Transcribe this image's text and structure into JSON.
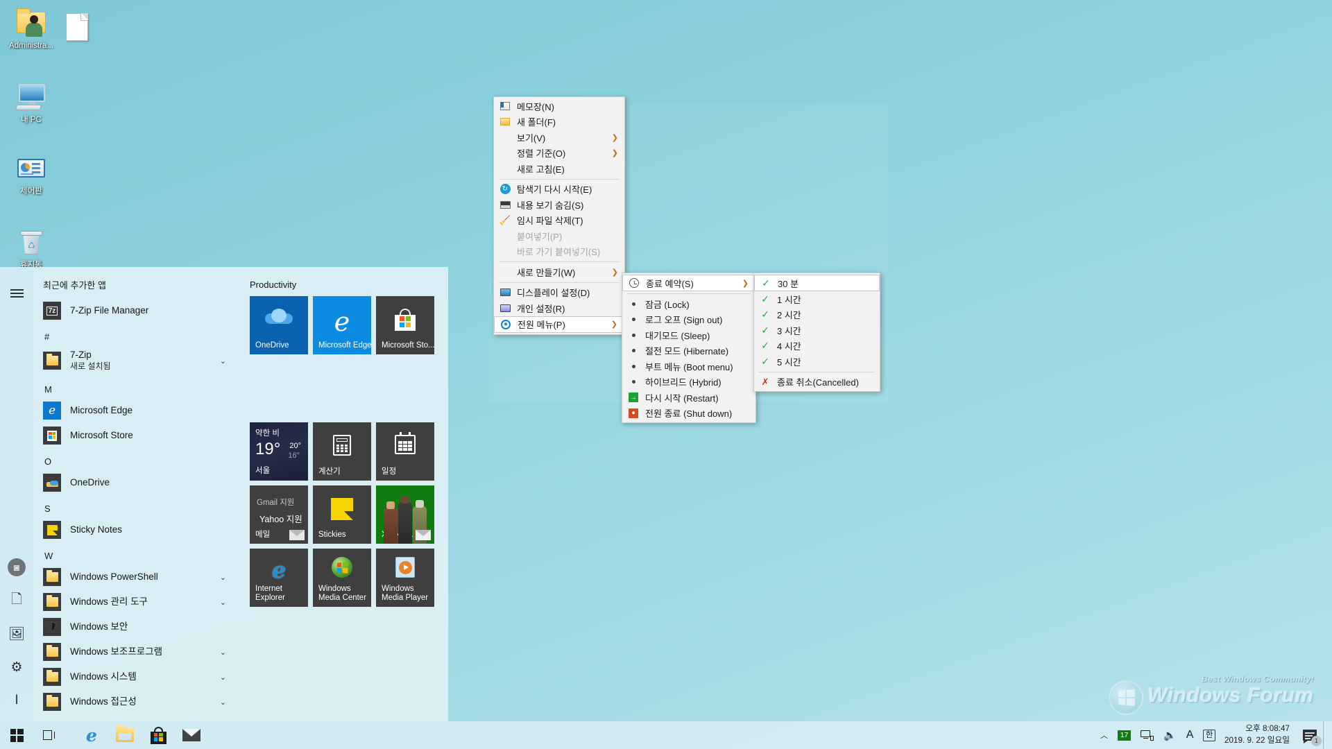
{
  "desktop": {
    "icons": [
      {
        "name": "administrator-folder",
        "label": "Administra...",
        "icon": "user-folder-icon"
      },
      {
        "name": "text-document",
        "label": "",
        "icon": "blank-document-icon"
      },
      {
        "name": "my-pc",
        "label": "내 PC",
        "icon": "computer-icon"
      },
      {
        "name": "control-panel",
        "label": "제어판",
        "icon": "control-panel-icon"
      },
      {
        "name": "recycle-bin",
        "label": "휴지통",
        "icon": "recycle-bin-icon"
      }
    ],
    "watermark": {
      "tagline": "Best Windows Community!",
      "title": "Windows Forum"
    },
    "background_color": "#8ed2de"
  },
  "start_menu": {
    "rail": [
      {
        "name": "hamburger",
        "icon": "hamburger-icon",
        "label": ""
      },
      {
        "name": "account",
        "icon": "user-avatar-icon",
        "label": ""
      },
      {
        "name": "documents",
        "icon": "document-icon",
        "label": ""
      },
      {
        "name": "pictures",
        "icon": "picture-icon",
        "label": ""
      },
      {
        "name": "settings",
        "icon": "gear-icon",
        "label": ""
      },
      {
        "name": "power",
        "icon": "power-icon",
        "label": ""
      }
    ],
    "recent_header": "최근에 추가한 앱",
    "recent_apps": [
      {
        "label": "7-Zip File Manager",
        "icon": "7zip-icon"
      }
    ],
    "sections": [
      {
        "letter": "#",
        "apps": [
          {
            "label": "7-Zip",
            "sub": "새로 설치됨",
            "icon": "folder-icon",
            "chevron": "⌄"
          }
        ]
      },
      {
        "letter": "M",
        "apps": [
          {
            "label": "Microsoft Edge",
            "sub": "",
            "icon": "edge-icon",
            "chevron": ""
          },
          {
            "label": "Microsoft Store",
            "sub": "",
            "icon": "store-icon",
            "chevron": ""
          }
        ]
      },
      {
        "letter": "O",
        "apps": [
          {
            "label": "OneDrive",
            "sub": "",
            "icon": "onedrive-icon",
            "chevron": ""
          }
        ]
      },
      {
        "letter": "S",
        "apps": [
          {
            "label": "Sticky Notes",
            "sub": "",
            "icon": "sticky-notes-icon",
            "chevron": ""
          }
        ]
      },
      {
        "letter": "W",
        "apps": [
          {
            "label": "Windows PowerShell",
            "sub": "",
            "icon": "folder-icon",
            "chevron": "⌄"
          },
          {
            "label": "Windows 관리 도구",
            "sub": "",
            "icon": "folder-icon",
            "chevron": "⌄"
          },
          {
            "label": "Windows 보안",
            "sub": "",
            "icon": "shield-icon",
            "chevron": ""
          },
          {
            "label": "Windows 보조프로그램",
            "sub": "",
            "icon": "folder-icon",
            "chevron": "⌄"
          },
          {
            "label": "Windows 시스템",
            "sub": "",
            "icon": "folder-icon",
            "chevron": "⌄"
          },
          {
            "label": "Windows 접근성",
            "sub": "",
            "icon": "folder-icon",
            "chevron": "⌄"
          }
        ]
      }
    ],
    "tile_group": "Productivity",
    "tiles_row1": [
      {
        "label": "OneDrive",
        "icon": "onedrive-icon",
        "color": "#0b63b0"
      },
      {
        "label": "Microsoft Edge",
        "icon": "edge-icon",
        "color": "#0b8ce0"
      },
      {
        "label": "Microsoft Sto...",
        "icon": "store-icon",
        "color": "#3f3f3f"
      }
    ],
    "weather_tile": {
      "condition": "약한 비",
      "temp_now": "19°",
      "temp_high": "20°",
      "temp_low": "16°",
      "city": "서울"
    },
    "tiles_row2": [
      {
        "label": "계산기",
        "icon": "calculator-icon",
        "color": "#3f3f3f"
      },
      {
        "label": "일정",
        "icon": "calendar-icon",
        "color": "#3f3f3f"
      }
    ],
    "mail_tile": {
      "ghost_top": "Gmail 지원",
      "ghost_mid": "Yahoo 지원",
      "label": "메일"
    },
    "tiles_row3": [
      {
        "label": "Stickies",
        "icon": "sticky-notes-icon",
        "color": "#3f3f3f"
      },
      {
        "label": "Xbox 본...",
        "icon": "xbox-icon",
        "color": "#107c10"
      }
    ],
    "tiles_row4": [
      {
        "label": "Internet Explorer",
        "icon": "internet-explorer-icon",
        "color": "#3f3f3f"
      },
      {
        "label": "Windows Media Center",
        "icon": "media-center-icon",
        "color": "#3f3f3f"
      },
      {
        "label": "Windows Media Player",
        "icon": "media-player-icon",
        "color": "#3f3f3f"
      }
    ]
  },
  "context_menu": {
    "items": [
      {
        "label": "메모장(N)",
        "icon": "notepad-icon",
        "arrow": "",
        "state": "normal"
      },
      {
        "label": "새 폴더(F)",
        "icon": "new-folder-icon",
        "arrow": "",
        "state": "normal"
      },
      {
        "label": "보기(V)",
        "icon": "",
        "arrow": "❯",
        "state": "normal"
      },
      {
        "label": "정렬 기준(O)",
        "icon": "",
        "arrow": "❯",
        "state": "normal"
      },
      {
        "label": "새로 고침(E)",
        "icon": "",
        "arrow": "",
        "state": "normal"
      },
      {
        "label": "",
        "icon": "",
        "arrow": "",
        "state": "separator"
      },
      {
        "label": "탐색기 다시 시작(E)",
        "icon": "refresh-icon",
        "arrow": "",
        "state": "normal"
      },
      {
        "label": "내용 보기 숨김(S)",
        "icon": "hide-content-icon",
        "arrow": "",
        "state": "normal"
      },
      {
        "label": "임시 파일 삭제(T)",
        "icon": "broom-icon",
        "arrow": "",
        "state": "normal"
      },
      {
        "label": "붙여넣기(P)",
        "icon": "",
        "arrow": "",
        "state": "disabled"
      },
      {
        "label": "바로 가기 붙여넣기(S)",
        "icon": "",
        "arrow": "",
        "state": "disabled"
      },
      {
        "label": "",
        "icon": "",
        "arrow": "",
        "state": "separator"
      },
      {
        "label": "새로 만들기(W)",
        "icon": "",
        "arrow": "❯",
        "state": "normal"
      },
      {
        "label": "",
        "icon": "",
        "arrow": "",
        "state": "separator"
      },
      {
        "label": "디스플레이 설정(D)",
        "icon": "display-settings-icon",
        "arrow": "",
        "state": "normal"
      },
      {
        "label": "개인 설정(R)",
        "icon": "personalize-icon",
        "arrow": "",
        "state": "normal"
      },
      {
        "label": "전원 메뉴(P)",
        "icon": "power-menu-icon",
        "arrow": "❯",
        "state": "selected"
      }
    ]
  },
  "power_menu": {
    "items": [
      {
        "label": "종료 예약(S)",
        "icon": "clock-icon",
        "arrow": "❯",
        "state": "highlight"
      },
      {
        "label": "",
        "icon": "",
        "arrow": "",
        "state": "separator"
      },
      {
        "label": "잠금 (Lock)",
        "icon": "bullet-icon",
        "arrow": "",
        "state": "normal"
      },
      {
        "label": "로그 오프 (Sign out)",
        "icon": "bullet-icon",
        "arrow": "",
        "state": "normal"
      },
      {
        "label": "대기모드 (Sleep)",
        "icon": "bullet-icon",
        "arrow": "",
        "state": "normal"
      },
      {
        "label": "절전 모드 (Hibernate)",
        "icon": "bullet-icon",
        "arrow": "",
        "state": "normal"
      },
      {
        "label": "부트 메뉴 (Boot menu)",
        "icon": "bullet-icon",
        "arrow": "",
        "state": "normal"
      },
      {
        "label": "하이브리드 (Hybrid)",
        "icon": "bullet-icon",
        "arrow": "",
        "state": "normal"
      },
      {
        "label": "다시 시작 (Restart)",
        "icon": "restart-icon",
        "arrow": "",
        "state": "normal"
      },
      {
        "label": "전원 종료 (Shut down)",
        "icon": "shutdown-icon",
        "arrow": "",
        "state": "normal"
      }
    ]
  },
  "timer_menu": {
    "items": [
      {
        "label": "30 분",
        "icon": "check-icon",
        "state": "highlight"
      },
      {
        "label": "1 시간",
        "icon": "check-icon",
        "state": "normal"
      },
      {
        "label": "2 시간",
        "icon": "check-icon",
        "state": "normal"
      },
      {
        "label": "3 시간",
        "icon": "check-icon",
        "state": "normal"
      },
      {
        "label": "4 시간",
        "icon": "check-icon",
        "state": "normal"
      },
      {
        "label": "5 시간",
        "icon": "check-icon",
        "state": "normal"
      },
      {
        "label": "",
        "icon": "",
        "state": "separator"
      },
      {
        "label": "종료 취소(Cancelled)",
        "icon": "x-icon",
        "state": "normal"
      }
    ]
  },
  "taskbar": {
    "start_button": {
      "name": "start-button",
      "icon": "windows-logo-icon"
    },
    "task_view": {
      "name": "task-view-button",
      "icon": "task-view-icon"
    },
    "pinned": [
      {
        "name": "edge",
        "icon": "edge-icon"
      },
      {
        "name": "file-explorer",
        "icon": "folder-icon"
      },
      {
        "name": "microsoft-store",
        "icon": "store-icon"
      },
      {
        "name": "mail",
        "icon": "mail-icon"
      }
    ],
    "tray": {
      "overflow": "︿",
      "calendar_badge": "17",
      "network_icon": "network-icon",
      "volume_icon": "speaker-icon",
      "ime_mode": "A",
      "ime_lang": "한",
      "clock_time": "오후 8:08:47",
      "clock_date": "2019. 9. 22  일요일",
      "notification_count": "1"
    }
  }
}
